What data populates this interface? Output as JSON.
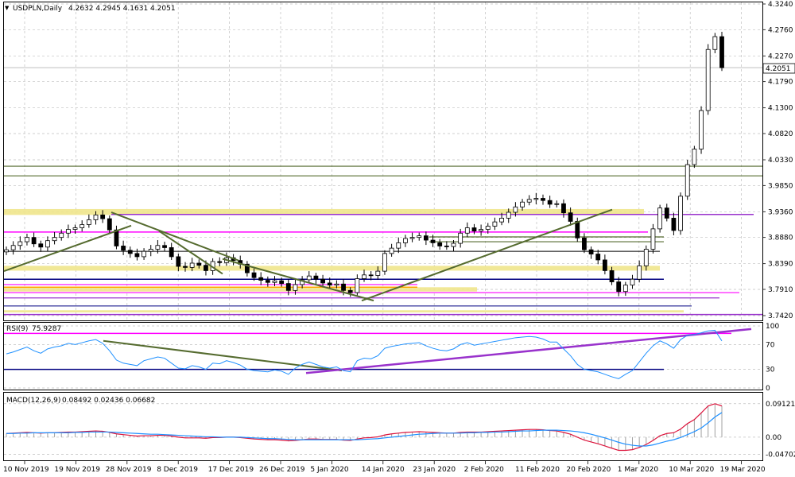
{
  "header": {
    "symbol": "USDPLN,Daily",
    "ohlc": "4.2632 4.2945 4.1631 4.2051"
  },
  "price_tag": "4.2051",
  "colors": {
    "bull": "#ffffff",
    "bear": "#000000",
    "grid": "#c0c0c0",
    "trend": "#556b2f",
    "magenta": "#ff00ff",
    "purple": "#9932cc",
    "navy": "#000080",
    "zone": "#f0e68c",
    "orange": "#ffa500",
    "rsi": "#1e90ff",
    "macd_signal": "#dc143c",
    "macd_hist": "#8b0000"
  },
  "chart_data": [
    {
      "type": "candlestick",
      "title": "USDPLN,Daily",
      "ylim": [
        3.742,
        4.324
      ],
      "y_ticks": [
        "4.3240",
        "4.2760",
        "4.2270",
        "4.1790",
        "4.1300",
        "4.0820",
        "4.0330",
        "3.9850",
        "3.9360",
        "3.8880",
        "3.8390",
        "3.7910",
        "3.7420"
      ],
      "y_tick_values": [
        4.324,
        4.276,
        4.227,
        4.179,
        4.13,
        4.082,
        4.033,
        3.985,
        3.936,
        3.888,
        3.839,
        3.791,
        3.742
      ],
      "x_ticks": [
        "10 Nov 2019",
        "19 Nov 2019",
        "28 Nov 2019",
        "8 Dec 2019",
        "17 Dec 2019",
        "26 Dec 2019",
        "5 Jan 2020",
        "14 Jan 2020",
        "23 Jan 2020",
        "2 Feb 2020",
        "11 Feb 2020",
        "20 Feb 2020",
        "1 Mar 2020",
        "10 Mar 2020",
        "19 Mar 2020"
      ],
      "close": [
        3.865,
        3.873,
        3.88,
        3.888,
        3.876,
        3.87,
        3.882,
        3.888,
        3.896,
        3.903,
        3.906,
        3.912,
        3.921,
        3.93,
        3.923,
        3.902,
        3.872,
        3.864,
        3.858,
        3.852,
        3.862,
        3.866,
        3.873,
        3.869,
        3.852,
        3.834,
        3.832,
        3.84,
        3.836,
        3.826,
        3.843,
        3.841,
        3.85,
        3.845,
        3.838,
        3.822,
        3.813,
        3.808,
        3.804,
        3.807,
        3.802,
        3.789,
        3.8,
        3.809,
        3.816,
        3.81,
        3.803,
        3.799,
        3.801,
        3.789,
        3.785,
        3.811,
        3.818,
        3.817,
        3.825,
        3.858,
        3.868,
        3.878,
        3.886,
        3.888,
        3.891,
        3.883,
        3.878,
        3.872,
        3.871,
        3.877,
        3.896,
        3.906,
        3.9,
        3.903,
        3.909,
        3.917,
        3.924,
        3.935,
        3.945,
        3.954,
        3.959,
        3.961,
        3.957,
        3.95,
        3.951,
        3.934,
        3.918,
        3.887,
        3.865,
        3.857,
        3.846,
        3.826,
        3.805,
        3.787,
        3.799,
        3.81,
        3.835,
        3.866,
        3.904,
        3.943,
        3.924,
        3.901,
        3.965,
        4.024,
        4.053,
        4.125,
        4.239,
        4.263,
        4.205
      ],
      "series": [
        {
          "name": "RSI(9)",
          "value": "75.9287"
        }
      ],
      "rsi": {
        "title": "RSI(9)",
        "last": "75.9287",
        "levels": [
          "100",
          "70",
          "30",
          "0"
        ],
        "values": [
          55,
          58,
          62,
          66,
          60,
          56,
          63,
          66,
          68,
          72,
          70,
          73,
          76,
          78,
          72,
          60,
          45,
          40,
          38,
          36,
          44,
          47,
          50,
          48,
          40,
          32,
          31,
          36,
          34,
          30,
          40,
          39,
          44,
          41,
          37,
          30,
          28,
          27,
          26,
          29,
          27,
          22,
          32,
          38,
          42,
          38,
          34,
          32,
          34,
          28,
          26,
          44,
          48,
          47,
          52,
          64,
          67,
          69,
          71,
          72,
          73,
          68,
          64,
          61,
          60,
          63,
          70,
          73,
          69,
          71,
          73,
          75,
          77,
          79,
          81,
          82,
          83,
          82,
          79,
          74,
          74,
          63,
          52,
          38,
          30,
          28,
          26,
          22,
          18,
          15,
          22,
          28,
          42,
          56,
          68,
          76,
          71,
          64,
          78,
          85,
          86,
          89,
          92,
          93,
          75.9
        ]
      },
      "macd": {
        "title": "MACD(12,26,9)",
        "params": "0.08492 0.02436 0.06682",
        "ticks": [
          "0.09121",
          "0.00",
          "-0.04702"
        ],
        "tick_values": [
          0.09121,
          0.0,
          -0.04702
        ],
        "hist": [
          0.01,
          0.011,
          0.012,
          0.013,
          0.012,
          0.011,
          0.012,
          0.012,
          0.013,
          0.014,
          0.014,
          0.015,
          0.016,
          0.017,
          0.016,
          0.013,
          0.009,
          0.007,
          0.005,
          0.003,
          0.004,
          0.004,
          0.005,
          0.005,
          0.003,
          0.0,
          -0.002,
          -0.002,
          -0.002,
          -0.003,
          -0.001,
          -0.001,
          0.0,
          0.0,
          -0.001,
          -0.003,
          -0.005,
          -0.006,
          -0.007,
          -0.007,
          -0.008,
          -0.01,
          -0.009,
          -0.007,
          -0.005,
          -0.005,
          -0.006,
          -0.006,
          -0.006,
          -0.008,
          -0.009,
          -0.005,
          -0.002,
          -0.001,
          0.001,
          0.006,
          0.009,
          0.011,
          0.013,
          0.014,
          0.015,
          0.014,
          0.013,
          0.012,
          0.011,
          0.011,
          0.013,
          0.014,
          0.014,
          0.014,
          0.015,
          0.016,
          0.017,
          0.018,
          0.019,
          0.02,
          0.021,
          0.021,
          0.02,
          0.018,
          0.017,
          0.013,
          0.008,
          0.0,
          -0.008,
          -0.013,
          -0.018,
          -0.024,
          -0.03,
          -0.036,
          -0.036,
          -0.034,
          -0.028,
          -0.02,
          -0.009,
          0.004,
          0.01,
          0.012,
          0.022,
          0.037,
          0.048,
          0.066,
          0.085,
          0.091,
          0.085
        ],
        "signal": [
          0.01,
          0.01,
          0.011,
          0.011,
          0.012,
          0.012,
          0.012,
          0.012,
          0.012,
          0.012,
          0.013,
          0.013,
          0.014,
          0.014,
          0.014,
          0.014,
          0.013,
          0.012,
          0.011,
          0.01,
          0.009,
          0.008,
          0.008,
          0.007,
          0.006,
          0.005,
          0.004,
          0.003,
          0.002,
          0.001,
          0.001,
          0.0,
          0.0,
          0.0,
          0.0,
          -0.001,
          -0.002,
          -0.003,
          -0.004,
          -0.004,
          -0.005,
          -0.006,
          -0.007,
          -0.007,
          -0.007,
          -0.007,
          -0.007,
          -0.007,
          -0.007,
          -0.007,
          -0.007,
          -0.007,
          -0.006,
          -0.005,
          -0.004,
          -0.002,
          0.0,
          0.002,
          0.004,
          0.006,
          0.008,
          0.009,
          0.01,
          0.011,
          0.011,
          0.011,
          0.011,
          0.012,
          0.012,
          0.013,
          0.013,
          0.014,
          0.014,
          0.015,
          0.016,
          0.017,
          0.017,
          0.018,
          0.019,
          0.019,
          0.019,
          0.018,
          0.017,
          0.015,
          0.012,
          0.008,
          0.003,
          -0.002,
          -0.008,
          -0.014,
          -0.019,
          -0.022,
          -0.024,
          -0.024,
          -0.021,
          -0.016,
          -0.011,
          -0.007,
          -0.001,
          0.007,
          0.015,
          0.025,
          0.039,
          0.055,
          0.067
        ]
      }
    }
  ]
}
